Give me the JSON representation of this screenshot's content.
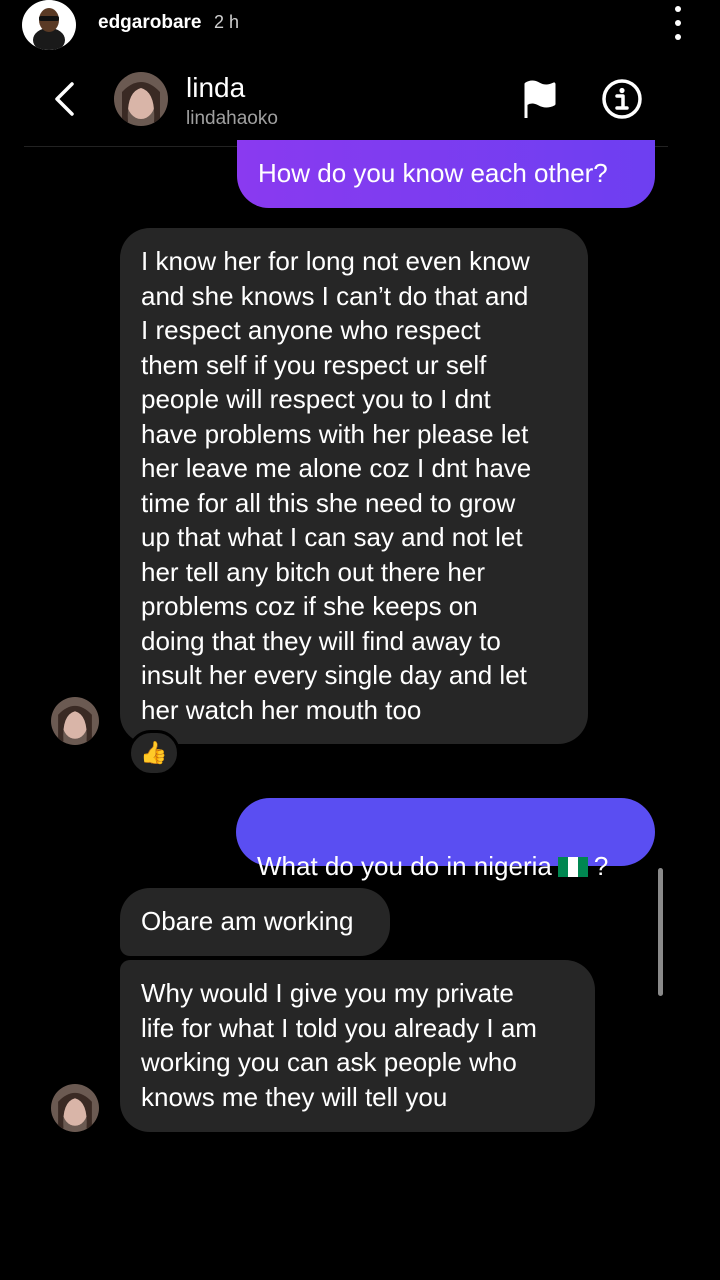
{
  "story": {
    "username": "edgarobare",
    "time": "2 h"
  },
  "chat": {
    "name": "linda",
    "handle": "lindahaoko"
  },
  "messages": {
    "m1": "How do you know each other?",
    "m2": "I know her for long not even know\nand she knows I can’t do that and\nI respect anyone who respect\nthem self if you respect ur self\npeople will respect you to I dnt\nhave problems with her please let\nher leave me alone coz I dnt have\ntime for all this she need to grow\nup that what I can say and not let\nher tell any bitch out there her\nproblems coz if she keeps on\ndoing that they will find away to\ninsult her every single day and let\nher watch her mouth too",
    "m2_reaction": "👍",
    "m3_pre": "What do you do in nigeria",
    "m3_post": "?",
    "m4": "Obare am working",
    "m5": "Why would I give you my private\nlife for what I told you already I am\nworking you can ask people who\nknows me they will tell you"
  },
  "icons": {
    "back": "chevron-left-icon",
    "flag": "flag-icon",
    "info": "info-icon",
    "more": "more-vertical-icon",
    "nigeria_flag": "nigeria-flag-emoji"
  },
  "colors": {
    "outgoing_start": "#8a3af0",
    "outgoing_end": "#6d3ff1",
    "incoming": "#262626",
    "background": "#000000"
  }
}
